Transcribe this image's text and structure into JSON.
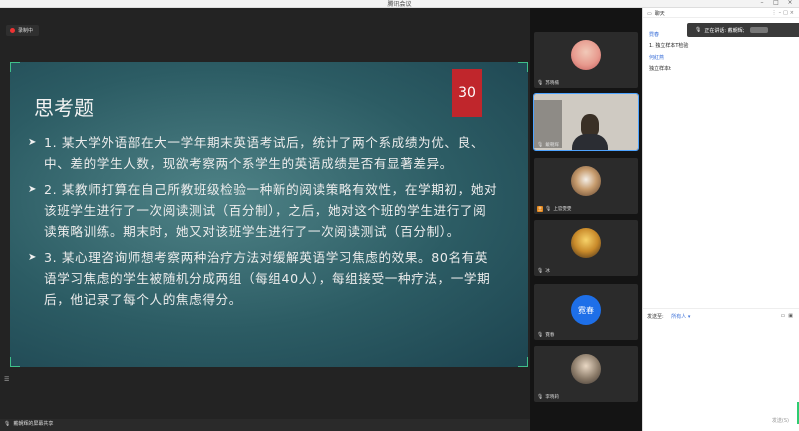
{
  "window": {
    "title": "腾讯会议"
  },
  "recording": {
    "label": "录制中"
  },
  "slide": {
    "title": "思考题",
    "page_number": "30",
    "bullets": [
      "1. 某大学外语部在大一学年期末英语考试后，统计了两个系成绩为优、良、中、差的学生人数，现欲考察两个系学生的英语成绩是否有显著差异。",
      "2. 某教师打算在自己所教班级检验一种新的阅读策略有效性，在学期初，她对该班学生进行了一次阅读测试（百分制），之后，她对这个班的学生进行了阅读策略训练。期末时，她又对该班学生进行了一次阅读测试（百分制）。",
      "3. 某心理咨询师想考察两种治疗方法对缓解英语学习焦虑的效果。80名有英语学习焦虑的学生被随机分成两组（每组40人），每组接受一种疗法，一学期后，他记录了每个人的焦虑得分。"
    ]
  },
  "share_indicator": "戴朝辉的屏幕共享",
  "participants": [
    {
      "name": "苏晓楠",
      "type": "avatar"
    },
    {
      "name": "戴朝辉",
      "type": "video"
    },
    {
      "name": "上官雯雯",
      "type": "avatar",
      "badge": "主"
    },
    {
      "name": "冰",
      "type": "avatar"
    },
    {
      "name": "霓春",
      "type": "initials",
      "initials": "霓春"
    },
    {
      "name": "李晓莉",
      "type": "avatar"
    }
  ],
  "chat": {
    "header": "聊天",
    "speaking_label": "正在讲话: 戴朝辉;",
    "messages": [
      {
        "sender": "霓春",
        "text": "1. 独立样本T检验"
      },
      {
        "sender": "何紅燕",
        "text": "独立样本t"
      }
    ],
    "send_to_label": "发送至:",
    "send_to_target": "所有人",
    "send_button": "发送(S)"
  },
  "colors": {
    "slide_bg": "#2c5c64",
    "page_badge": "#c0262c",
    "accent_green": "#3fbf8a",
    "chat_sender": "#3a6fd8",
    "initials_avatar": "#1e6fe8"
  }
}
